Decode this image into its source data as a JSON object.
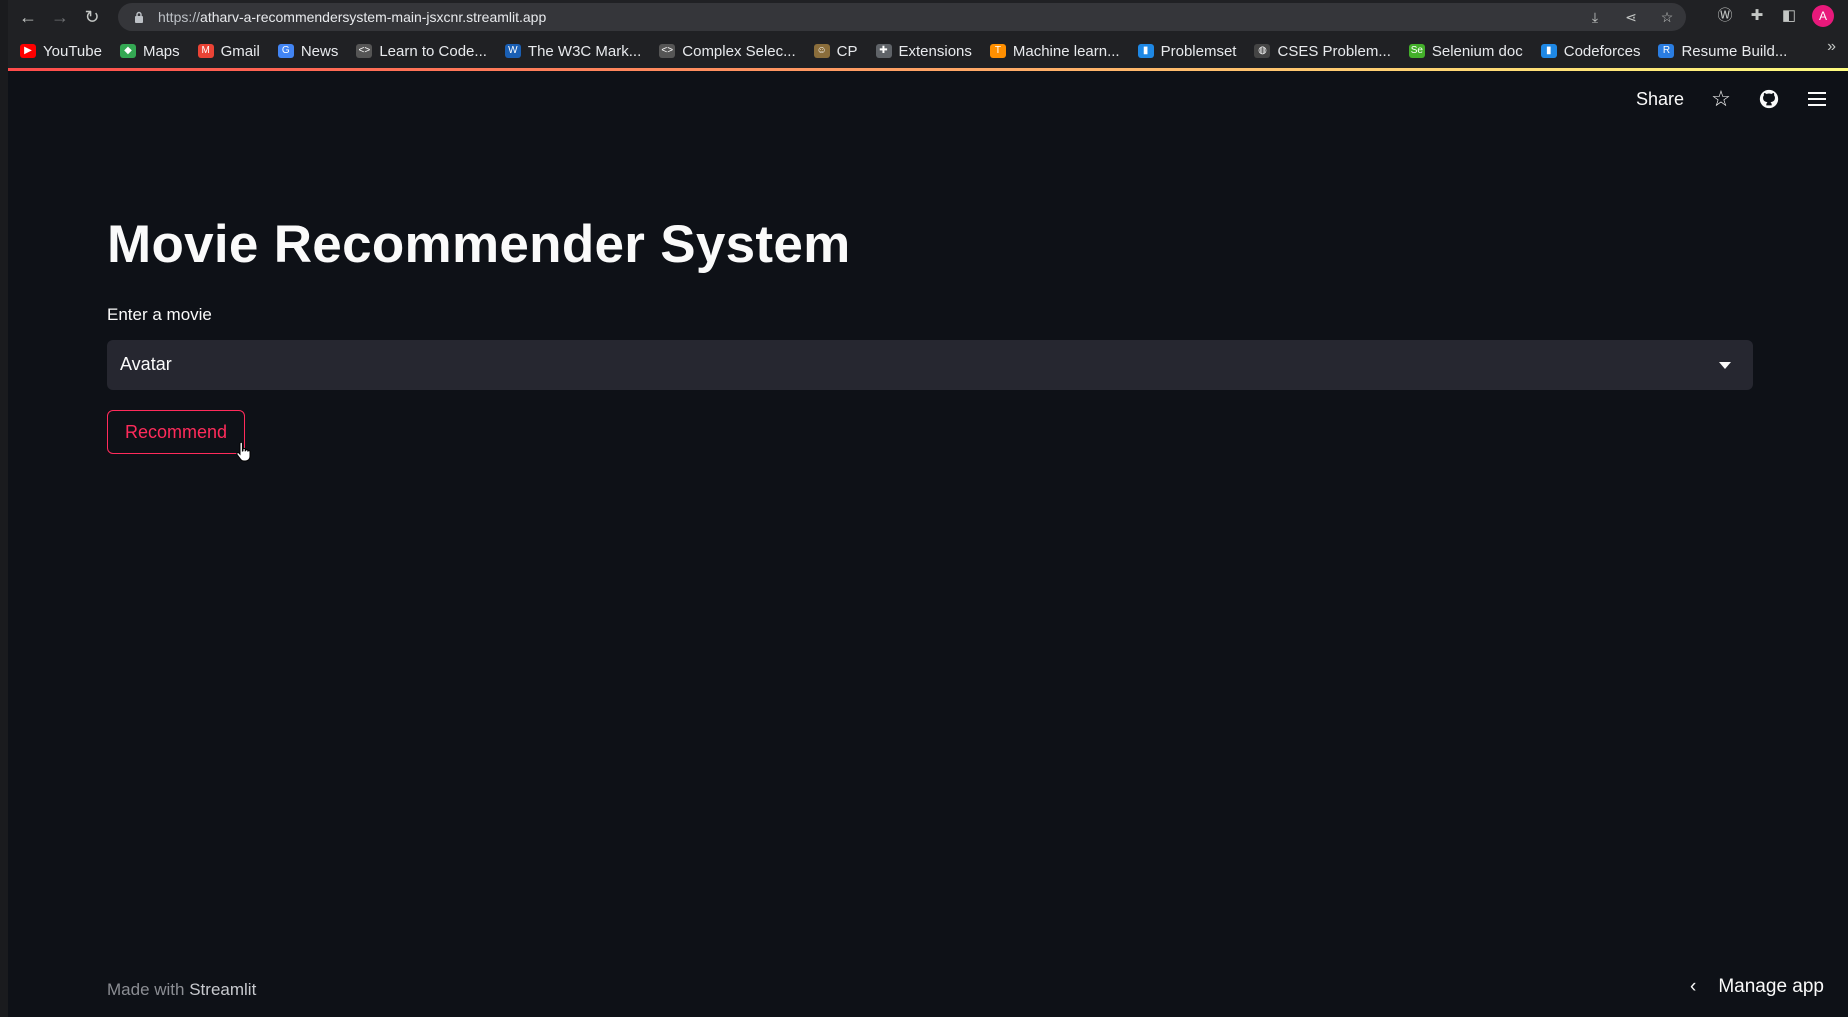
{
  "browser": {
    "url_prefix": "https://",
    "url_host": "atharv-a-recommendersystem-main-jsxcnr.streamlit.app",
    "profile_initial": "A",
    "bookmarks": [
      {
        "label": "YouTube",
        "icon": "youtube-icon",
        "color": "#ff0000",
        "glyph": "▶"
      },
      {
        "label": "Maps",
        "icon": "maps-icon",
        "color": "#34a853",
        "glyph": "◆"
      },
      {
        "label": "Gmail",
        "icon": "gmail-icon",
        "color": "#ea4335",
        "glyph": "M"
      },
      {
        "label": "News",
        "icon": "news-icon",
        "color": "#4285f4",
        "glyph": "G"
      },
      {
        "label": "Learn to Code...",
        "icon": "code-icon",
        "color": "#555555",
        "glyph": "<>"
      },
      {
        "label": "The W3C Mark...",
        "icon": "w3c-icon",
        "color": "#1a5fb4",
        "glyph": "W"
      },
      {
        "label": "Complex Selec...",
        "icon": "code-icon",
        "color": "#555555",
        "glyph": "<>"
      },
      {
        "label": "CP",
        "icon": "cp-icon",
        "color": "#8a6d3b",
        "glyph": "☺"
      },
      {
        "label": "Extensions",
        "icon": "puzzle-icon",
        "color": "#5f6368",
        "glyph": "✚"
      },
      {
        "label": "Machine learn...",
        "icon": "tensorflow-icon",
        "color": "#ff8f00",
        "glyph": "T"
      },
      {
        "label": "Problemset",
        "icon": "bars-icon",
        "color": "#1e88e5",
        "glyph": "▮"
      },
      {
        "label": "CSES Problem...",
        "icon": "globe-icon",
        "color": "#444444",
        "glyph": "◍"
      },
      {
        "label": "Selenium doc",
        "icon": "selenium-icon",
        "color": "#43b02a",
        "glyph": "Se"
      },
      {
        "label": "Codeforces",
        "icon": "bars-icon",
        "color": "#1e88e5",
        "glyph": "▮"
      },
      {
        "label": "Resume Build...",
        "icon": "resume-icon",
        "color": "#2a7de1",
        "glyph": "R"
      }
    ]
  },
  "header": {
    "share_label": "Share"
  },
  "main": {
    "title": "Movie Recommender System",
    "select_label": "Enter a movie",
    "select_value": "Avatar",
    "button_label": "Recommend"
  },
  "footer": {
    "made_with": "Made with",
    "brand": "Streamlit",
    "manage_label": "Manage app"
  },
  "colors": {
    "background": "#0e1117",
    "accent": "#ff2b5b",
    "select_bg": "#262730"
  }
}
